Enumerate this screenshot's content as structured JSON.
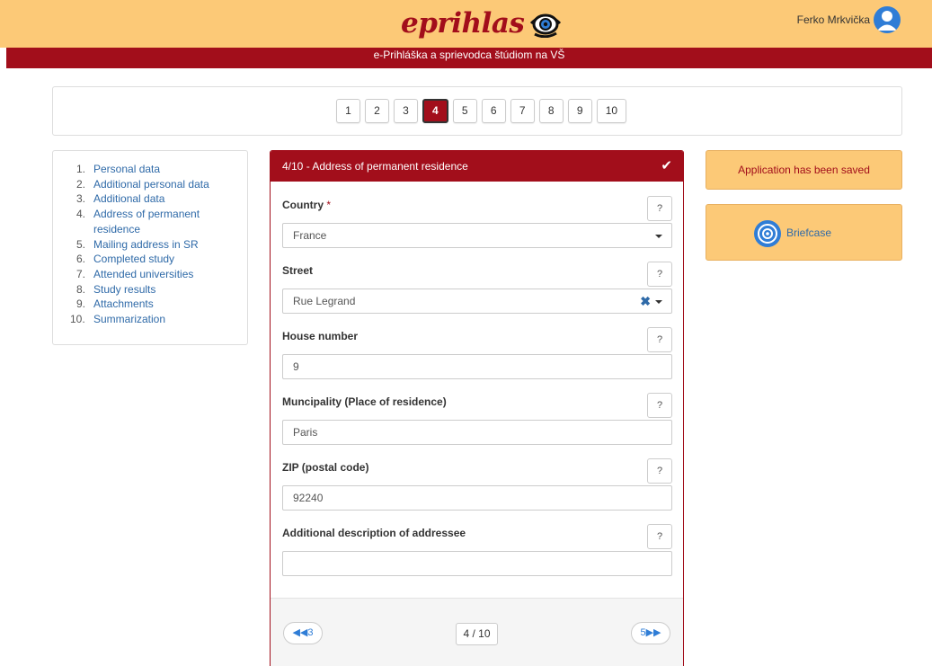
{
  "header": {
    "logo_text": "eprihlas",
    "user_name": "Ferko Mrkvička",
    "subtitle": "e-Prihláška a sprievodca štúdiom na VŠ"
  },
  "steps": {
    "items": [
      "1",
      "2",
      "3",
      "4",
      "5",
      "6",
      "7",
      "8",
      "9",
      "10"
    ],
    "active": "4"
  },
  "menu": {
    "items": [
      {
        "num": "1.",
        "label": "Personal data"
      },
      {
        "num": "2.",
        "label": "Additional personal data"
      },
      {
        "num": "3.",
        "label": "Additional data"
      },
      {
        "num": "4.",
        "label": "Address of permanent residence"
      },
      {
        "num": "5.",
        "label": "Mailing address in SR"
      },
      {
        "num": "6.",
        "label": "Completed study"
      },
      {
        "num": "7.",
        "label": "Attended universities"
      },
      {
        "num": "8.",
        "label": "Study results"
      },
      {
        "num": "9.",
        "label": "Attachments"
      },
      {
        "num": "10.",
        "label": "Summarization"
      }
    ]
  },
  "form": {
    "title": "4/10 - Address of permanent residence",
    "help_label": "?",
    "country": {
      "label": "Country",
      "required": "*",
      "value": "France"
    },
    "street": {
      "label": "Street",
      "value": "Rue Legrand"
    },
    "house": {
      "label": "House number",
      "value": "9"
    },
    "municipality": {
      "label": "Muncipality (Place of residence)",
      "value": "Paris"
    },
    "zip": {
      "label": "ZIP (postal code)",
      "value": "92240"
    },
    "additional": {
      "label": "Additional description of addressee",
      "value": ""
    },
    "prev_label": "3",
    "page_indicator": "4 / 10",
    "next_label": "5"
  },
  "sidebar": {
    "saved_message": "Application has been saved",
    "briefcase_label": "Briefcase"
  },
  "colors": {
    "brand_red": "#a20e1b",
    "brand_yellow": "#fcc977",
    "link_blue": "#2f6aa8"
  }
}
